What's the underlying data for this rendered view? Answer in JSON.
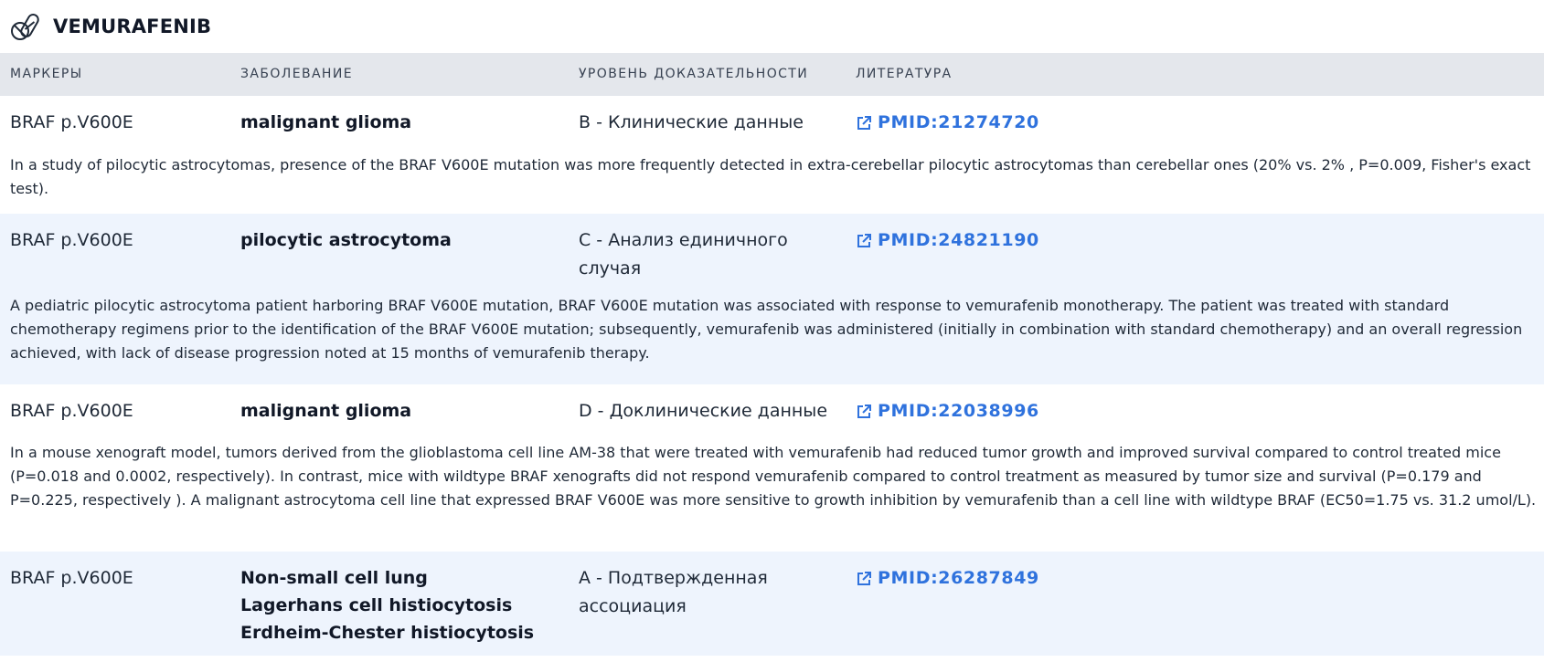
{
  "drug": {
    "title": "VEMURAFENIB",
    "icon": "pills-icon"
  },
  "table": {
    "headers": {
      "markers": "МАРКЕРЫ",
      "disease": "ЗАБОЛЕВАНИЕ",
      "evidence": "УРОВЕНЬ ДОКАЗАТЕЛЬНОСТИ",
      "literature": "ЛИТЕРАТУРА"
    },
    "rows": [
      {
        "marker": "BRAF p.V600E",
        "diseases": [
          "malignant glioma"
        ],
        "level": "B - Клинические данные",
        "pmid": "PMID:21274720",
        "description": "In a study of pilocytic astrocytomas, presence of the BRAF V600E mutation was more frequently detected in extra-cerebellar pilocytic astrocytomas than cerebellar ones (20% vs. 2% , P=0.009, Fisher's exact test)."
      },
      {
        "marker": "BRAF p.V600E",
        "diseases": [
          "pilocytic astrocytoma"
        ],
        "level": "C - Анализ единичного случая",
        "pmid": "PMID:24821190",
        "description": "A pediatric pilocytic astrocytoma patient harboring BRAF V600E mutation, BRAF V600E mutation was associated with response to vemurafenib monotherapy. The patient was treated with standard chemotherapy regimens prior to the identification of the BRAF V600E mutation; subsequently, vemurafenib was administered (initially in combination with standard chemotherapy) and an overall regression achieved, with lack of disease progression noted at 15 months of vemurafenib therapy."
      },
      {
        "marker": "BRAF p.V600E",
        "diseases": [
          "malignant glioma"
        ],
        "level": "D - Доклинические данные",
        "pmid": "PMID:22038996",
        "description": "In a mouse xenograft model, tumors derived from the glioblastoma cell line AM-38 that were treated with vemurafenib had reduced tumor growth and improved survival compared to control treated mice (P=0.018 and 0.0002, respectively). In contrast, mice with wildtype BRAF xenografts did not respond vemurafenib compared to control treatment as measured by tumor size and survival (P=0.179 and P=0.225, respectively ). A malignant astrocytoma cell line that expressed BRAF V600E was more sensitive to growth inhibition by vemurafenib than a cell line with wildtype BRAF (EC50=1.75 vs. 31.2 umol/L)."
      },
      {
        "marker": "BRAF p.V600E",
        "diseases": [
          "Non-small cell lung",
          "Lagerhans cell histiocytosis",
          "Erdheim-Chester histiocytosis"
        ],
        "level": "A - Подтвержденная ассоциация",
        "pmid": "PMID:26287849",
        "description": ""
      }
    ]
  },
  "colors": {
    "header_bg": "#e4e7ec",
    "alt_row_bg": "#eef4fd",
    "link": "#2f72dd"
  },
  "icons": {
    "link": "external-link-icon"
  }
}
